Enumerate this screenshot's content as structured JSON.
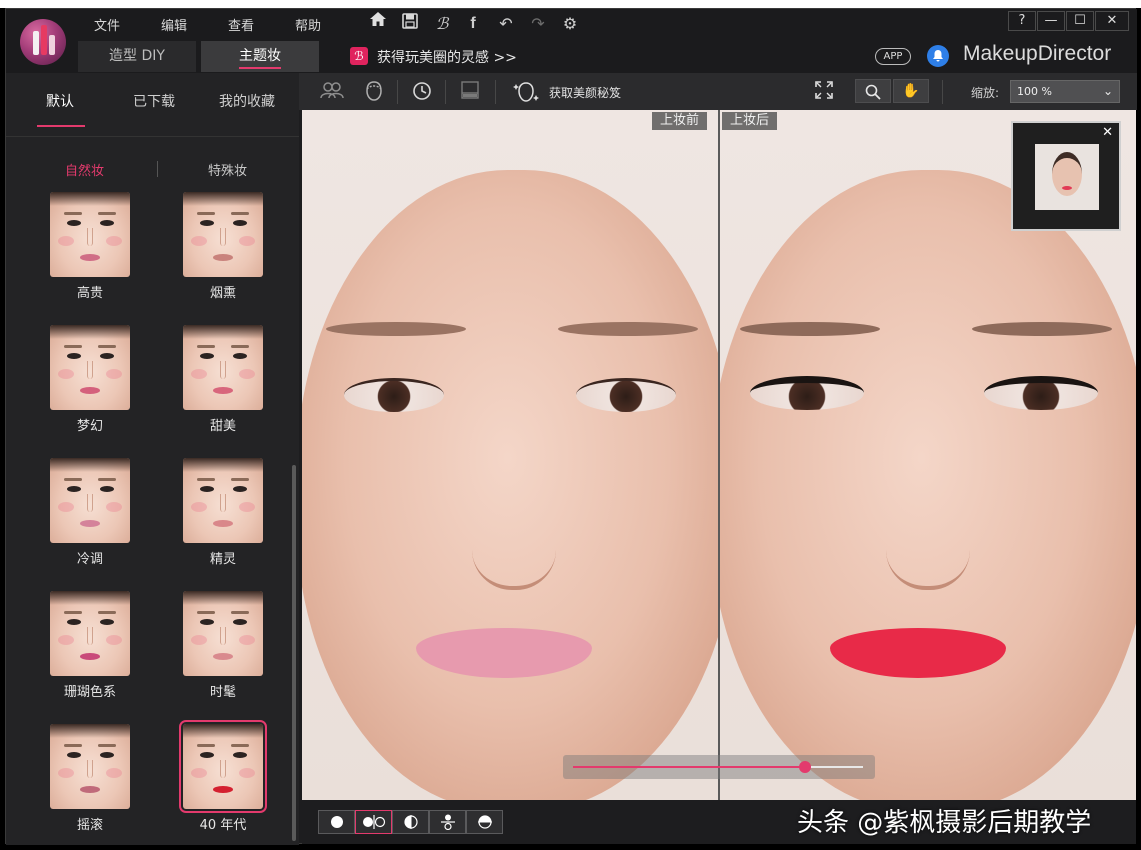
{
  "app": {
    "brand": "MakeupDirector",
    "menu": [
      "文件",
      "编辑",
      "查看",
      "帮助"
    ],
    "tabs": [
      {
        "label": "造型 DIY",
        "active": false
      },
      {
        "label": "主题妆",
        "active": true
      }
    ],
    "promo_text": "获得玩美圈的灵感 >>",
    "app_badge": "APP",
    "window_buttons": [
      "?",
      "—",
      "☐",
      "✕"
    ]
  },
  "left_panel": {
    "tabs": [
      {
        "label": "默认",
        "active": true
      },
      {
        "label": "已下载",
        "active": false
      },
      {
        "label": "我的收藏",
        "active": false
      }
    ],
    "subtabs": [
      {
        "label": "自然妆",
        "active": true
      },
      {
        "label": "特殊妆",
        "active": false
      }
    ],
    "looks": [
      {
        "label": "高贵",
        "lip": "#d06d86"
      },
      {
        "label": "烟熏",
        "lip": "#c9827c"
      },
      {
        "label": "梦幻",
        "lip": "#d4607c"
      },
      {
        "label": "甜美",
        "lip": "#d8667c"
      },
      {
        "label": "冷调",
        "lip": "#d4829a"
      },
      {
        "label": "精灵",
        "lip": "#d9878a"
      },
      {
        "label": "珊瑚色系",
        "lip": "#c94a7a"
      },
      {
        "label": "时髦",
        "lip": "#d98a8e"
      },
      {
        "label": "摇滚",
        "lip": "#c06a7a"
      },
      {
        "label": "40 年代",
        "lip": "#d42030",
        "selected": true
      }
    ]
  },
  "toolbar": {
    "get_tips": "获取美颜秘笈",
    "zoom_label": "缩放:",
    "zoom_value": "100 %"
  },
  "canvas": {
    "before_label": "上妆前",
    "after_label": "上妆后",
    "before_lip": "#e79aae",
    "after_lip": "#e82a48",
    "accent": "#e33a6d",
    "intensity_fraction": 0.8
  },
  "watermark": "头条 @紫枫摄影后期教学"
}
